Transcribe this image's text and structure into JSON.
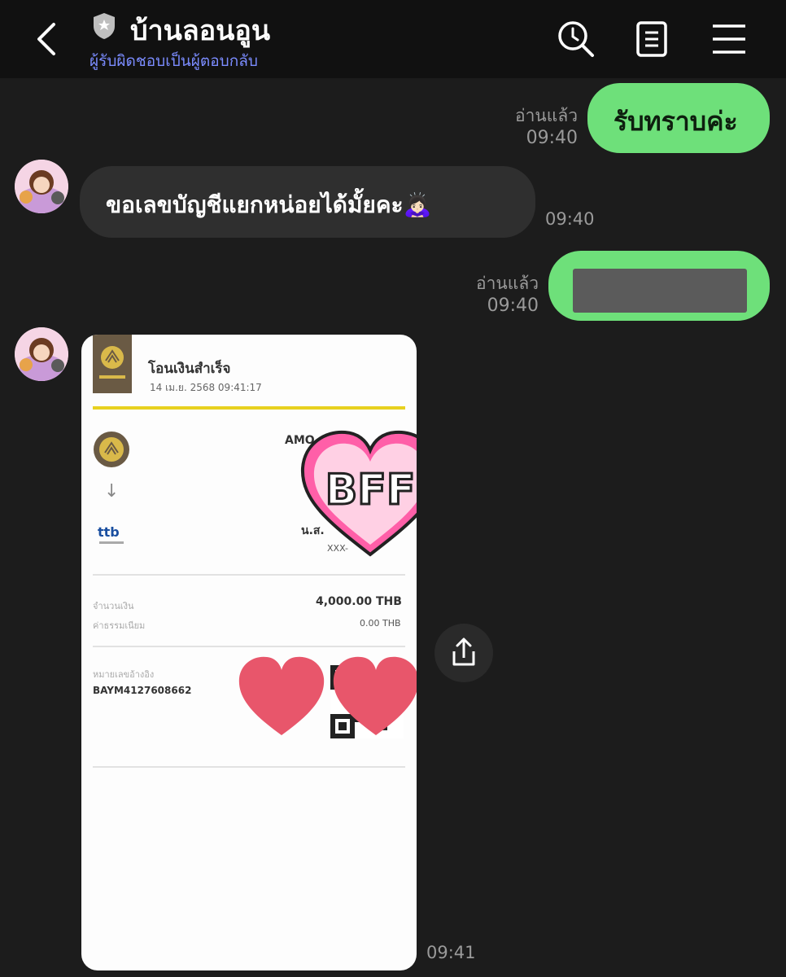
{
  "header": {
    "title": "บ้านลอนอูน",
    "subtitle": "ผู้รับผิดชอบเป็นผู้ตอบกลับ"
  },
  "messages": {
    "m1": {
      "text": "รับทราบค่ะ",
      "read": "อ่านแล้ว",
      "time": "09:40"
    },
    "m2": {
      "text": "ขอเลขบัญชีแยกหน่อยได้มั้ยคะ🙇🏻‍♀️",
      "time": "09:40"
    },
    "m3": {
      "read": "อ่านแล้ว",
      "time": "09:40"
    },
    "m4": {
      "time": "09:41"
    }
  },
  "receipt": {
    "title": "โอนเงินสำเร็จ",
    "date": "14 เม.ย. 2568 09:41:17",
    "sender_name": "AMO",
    "receiver_name": "น.ส.",
    "receiver_account": "XXX-",
    "amount_label": "จำนวนเงิน",
    "amount": "4,000.00 THB",
    "fee_label": "ค่าธรรมเนียม",
    "fee": "0.00 THB",
    "ref_label": "หมายเลขอ้างอิง",
    "ref_no": "BAYM4127608662",
    "sticker_text": "BFF"
  },
  "icons": {
    "back": "chevron-left-icon",
    "shield": "shield-icon",
    "search": "search-clock-icon",
    "notes": "notes-icon",
    "menu": "menu-icon",
    "share": "share-icon"
  },
  "colors": {
    "outgoing_bubble": "#6ee07a",
    "incoming_bubble": "#2f2f2f",
    "subtitle": "#7b8cff",
    "background": "#1c1c1c"
  }
}
